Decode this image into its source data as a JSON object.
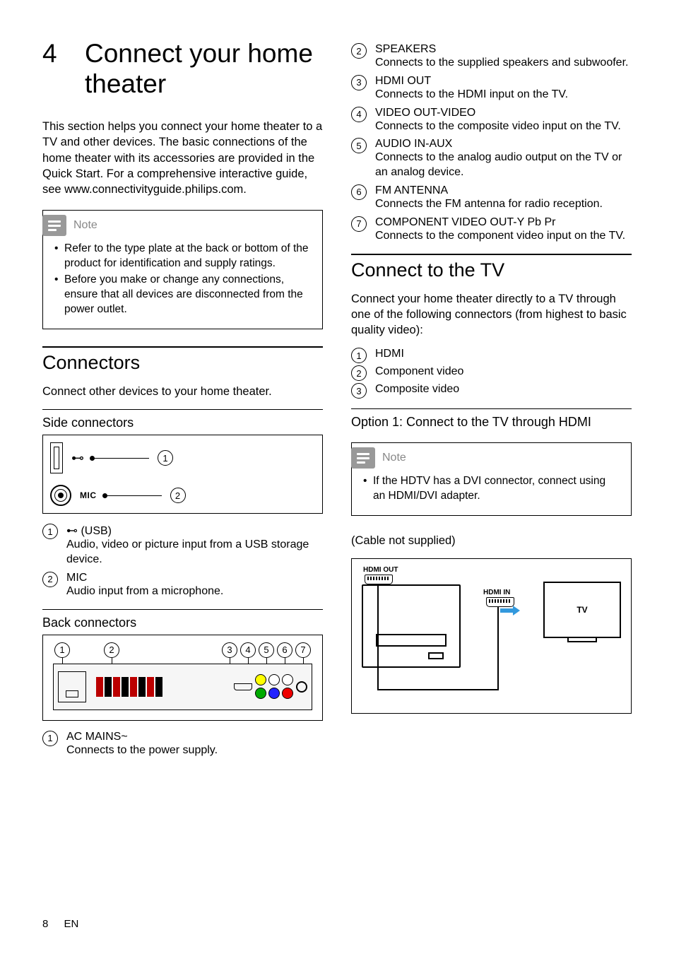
{
  "chapter": {
    "number": "4",
    "title": "Connect your home theater"
  },
  "intro": "This section helps you connect your home theater to a TV and other devices. The basic connections of the home theater with its accessories are provided in the Quick Start. For a comprehensive interactive guide, see www.connectivityguide.philips.com.",
  "note1": {
    "label": "Note",
    "items": [
      "Refer to the type plate at the back or bottom of the product for identification and supply ratings.",
      "Before you make or change any connections, ensure that all devices are disconnected from the power outlet."
    ]
  },
  "connectors": {
    "heading": "Connectors",
    "intro": "Connect other devices to your home theater.",
    "side_heading": "Side connectors",
    "side_fig": {
      "mic_label": "MIC"
    },
    "side_items": [
      {
        "num": "1",
        "label_prefix": "⊷",
        "label": "(USB)",
        "desc": "Audio, video or picture input from a USB storage device."
      },
      {
        "num": "2",
        "label": "MIC",
        "desc": "Audio input from a microphone."
      }
    ],
    "back_heading": "Back connectors",
    "back_items_col1": [
      {
        "num": "1",
        "label": "AC MAINS~",
        "desc": "Connects to the power supply."
      }
    ],
    "back_items_col2": [
      {
        "num": "2",
        "label": "SPEAKERS",
        "desc": "Connects to the supplied speakers and subwoofer."
      },
      {
        "num": "3",
        "label": "HDMI OUT",
        "desc": "Connects to the HDMI input on the TV."
      },
      {
        "num": "4",
        "label": "VIDEO OUT-VIDEO",
        "desc": "Connects to the composite video input on the TV."
      },
      {
        "num": "5",
        "label": "AUDIO IN-AUX",
        "desc": "Connects to the analog audio output on the TV or an analog device."
      },
      {
        "num": "6",
        "label": "FM ANTENNA",
        "desc": "Connects the FM antenna for radio reception."
      },
      {
        "num": "7",
        "label": "COMPONENT VIDEO OUT-Y Pb Pr",
        "desc": "Connects to the component video input on the TV."
      }
    ]
  },
  "connect_tv": {
    "heading": "Connect to the TV",
    "intro": "Connect your home theater directly to a TV through one of the following connectors (from highest to basic quality video):",
    "options": [
      {
        "num": "1",
        "label": "HDMI"
      },
      {
        "num": "2",
        "label": "Component video"
      },
      {
        "num": "3",
        "label": "Composite video"
      }
    ],
    "option1_heading": "Option 1: Connect to the TV through HDMI",
    "note": {
      "label": "Note",
      "items": [
        "If the HDTV has a DVI connector, connect using an HDMI/DVI adapter."
      ]
    },
    "cable_note": "(Cable not supplied)",
    "diagram": {
      "hdmi_out": "HDMI OUT",
      "hdmi_in": "HDMI IN",
      "tv": "TV"
    }
  },
  "footer": {
    "page": "8",
    "lang": "EN"
  }
}
